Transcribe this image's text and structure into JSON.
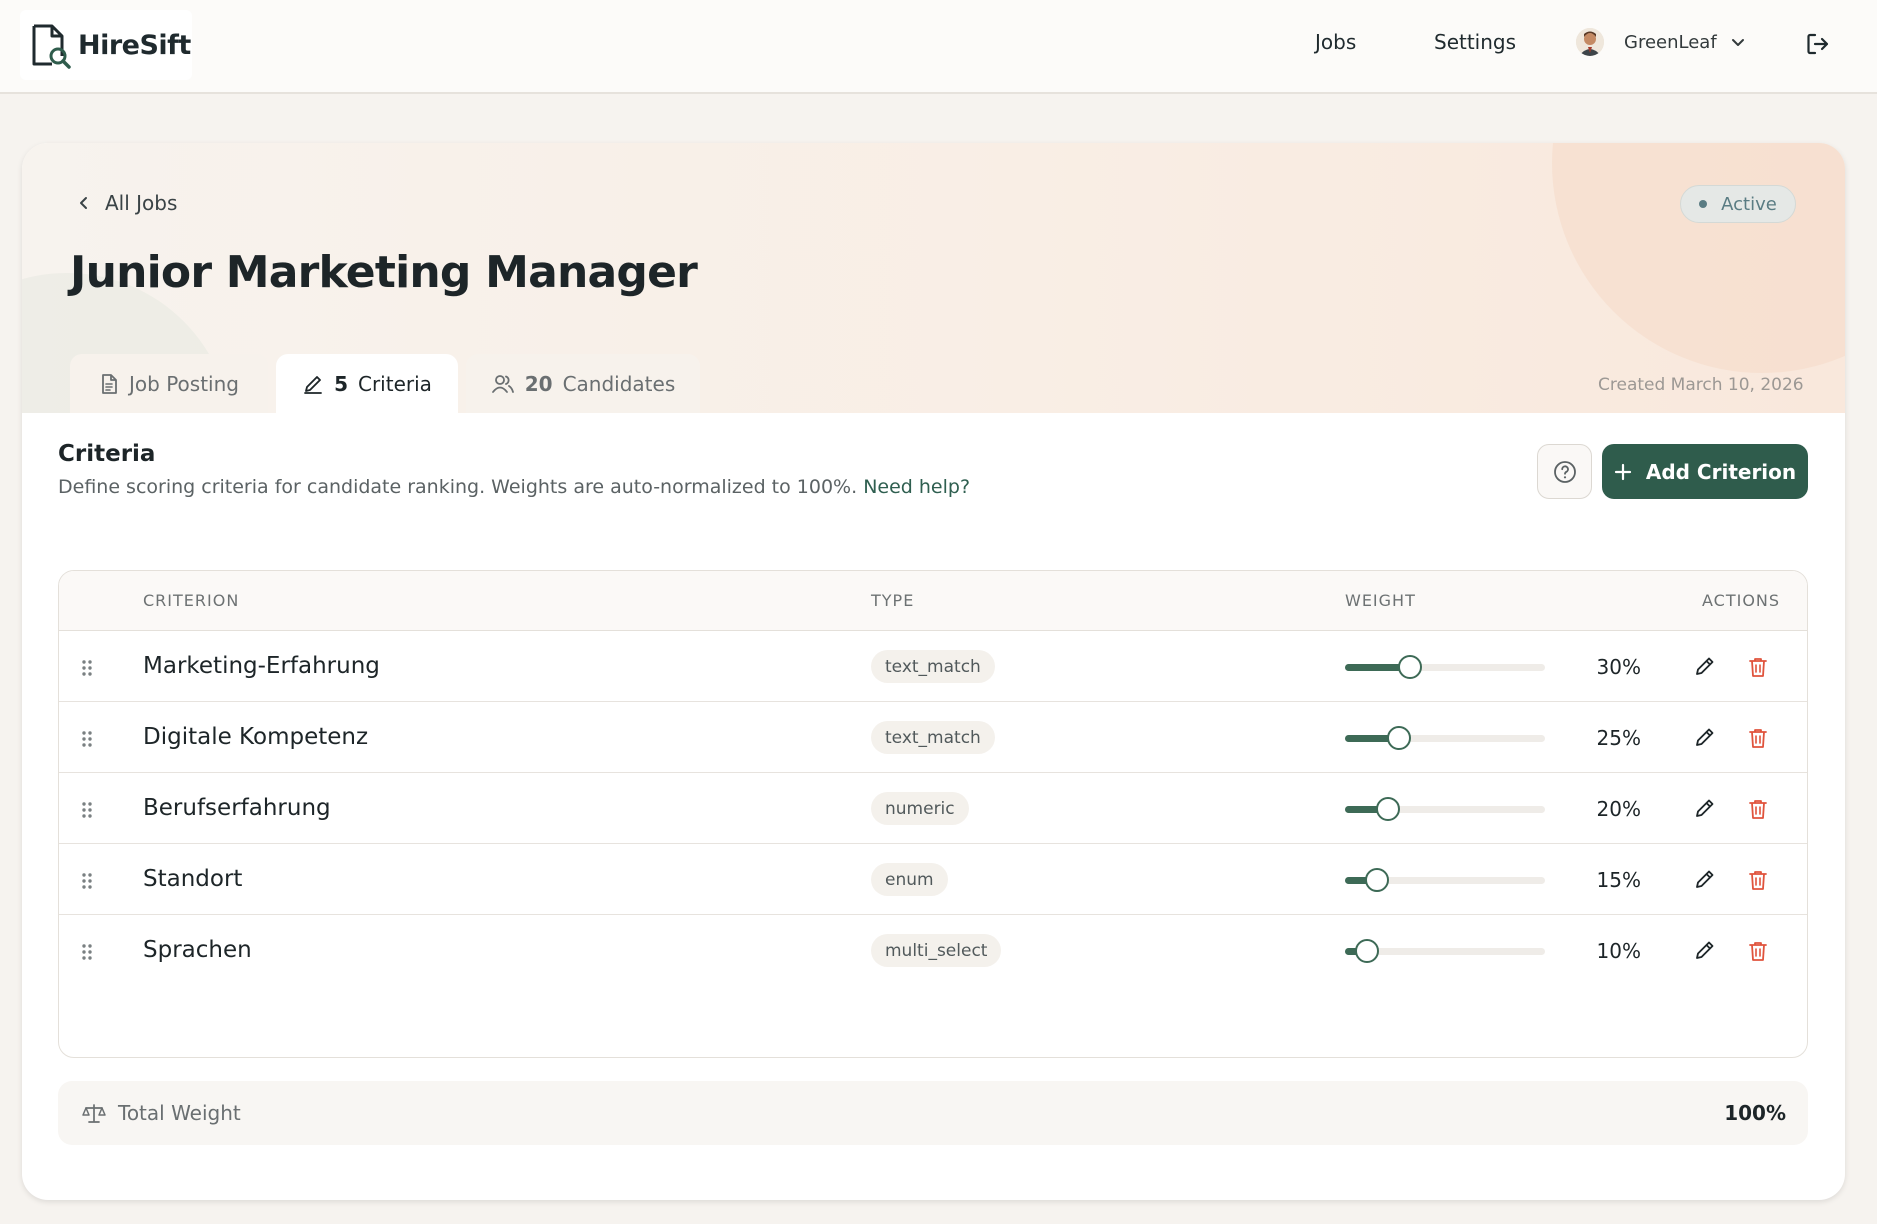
{
  "header": {
    "logo_text": "HireSift",
    "nav": {
      "jobs": "Jobs",
      "settings": "Settings"
    },
    "user": {
      "name": "GreenLeaf"
    }
  },
  "job": {
    "back_label": "All Jobs",
    "title": "Junior Marketing Manager",
    "status": "Active",
    "created": "Created March 10, 2026",
    "tabs": [
      {
        "count": "",
        "label": "Job Posting"
      },
      {
        "count": "5",
        "label": "Criteria"
      },
      {
        "count": "20",
        "label": "Candidates"
      }
    ]
  },
  "criteria": {
    "title": "Criteria",
    "description": "Define scoring criteria for candidate ranking. Weights are auto-normalized to 100%.",
    "help_link": "Need help?",
    "add_button": "Add Criterion",
    "columns": {
      "criterion": "CRITERION",
      "type": "TYPE",
      "weight": "WEIGHT",
      "actions": "ACTIONS"
    },
    "rows": [
      {
        "name": "Marketing-Erfahrung",
        "type": "text_match",
        "weight": 30,
        "weight_label": "30%"
      },
      {
        "name": "Digitale Kompetenz",
        "type": "text_match",
        "weight": 25,
        "weight_label": "25%"
      },
      {
        "name": "Berufserfahrung",
        "type": "numeric",
        "weight": 20,
        "weight_label": "20%"
      },
      {
        "name": "Standort",
        "type": "enum",
        "weight": 15,
        "weight_label": "15%"
      },
      {
        "name": "Sprachen",
        "type": "multi_select",
        "weight": 10,
        "weight_label": "10%"
      }
    ],
    "total_label": "Total Weight",
    "total_value": "100%"
  },
  "colors": {
    "accent": "#2f5c4c",
    "slider": "#3d6a56",
    "danger": "#e0533c",
    "status": "#5a7c83"
  }
}
